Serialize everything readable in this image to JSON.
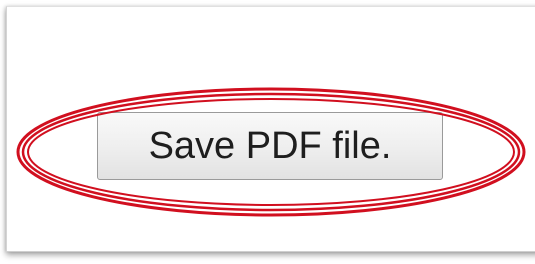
{
  "save_button": {
    "label": "Save PDF file."
  },
  "highlight": {
    "color": "#d10f1f",
    "shape": "ellipse"
  }
}
